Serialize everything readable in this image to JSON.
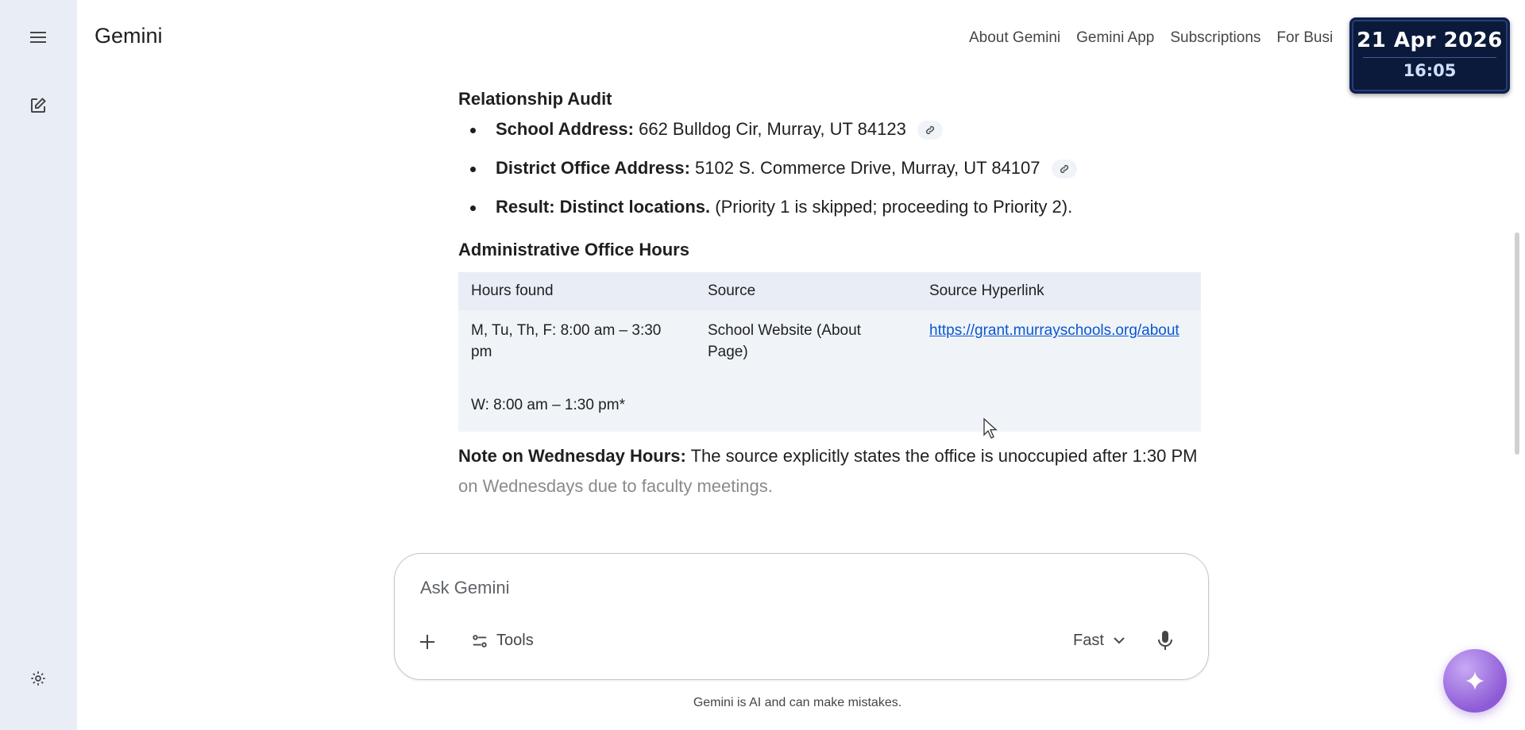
{
  "app": {
    "brand": "Gemini"
  },
  "nav": [
    "About Gemini",
    "Gemini App",
    "Subscriptions",
    "For Busi"
  ],
  "clock": {
    "date": "21 Apr 2026",
    "time": "16:05"
  },
  "relationship": {
    "heading": "Relationship Audit",
    "items": [
      {
        "label": "School Address:",
        "value": " 662 Bulldog Cir, Murray, UT 84123"
      },
      {
        "label": "District Office Address:",
        "value": " 5102 S. Commerce Drive, Murray, UT 84107"
      },
      {
        "label": "Result: Distinct locations.",
        "value": " (Priority 1 is skipped; proceeding to Priority 2)."
      }
    ]
  },
  "office_hours": {
    "heading": "Administrative Office Hours",
    "columns": [
      "Hours found",
      "Source",
      "Source Hyperlink"
    ],
    "rows": [
      [
        "M, Tu, Th, F: 8:00 am – 3:30 pm",
        "School Website (About Page)",
        "https://grant.murrayschools.org/about"
      ],
      [
        "W: 8:00 am – 1:30 pm*",
        "",
        ""
      ]
    ]
  },
  "note": {
    "label": "Note on Wednesday Hours:",
    "text": " The source explicitly states the office is unoccupied after 1:30 PM",
    "text_faded": "on Wednesdays due to faculty meetings."
  },
  "composer": {
    "placeholder": "Ask Gemini",
    "tools_label": "Tools",
    "mode_label": "Fast"
  },
  "disclaimer": "Gemini is AI and can make mistakes.",
  "icons": [
    "menu-icon",
    "new-chat-icon",
    "settings-icon",
    "link-icon",
    "plus-icon",
    "tools-icon",
    "chevron-down-icon",
    "mic-icon",
    "sparkle-icon"
  ],
  "colors": {
    "rail": "#e9eef6",
    "link": "#0b57d0",
    "table_head": "#e9eef6",
    "table_body": "#f0f4f9",
    "clock_bg": "#0b1a3a"
  }
}
